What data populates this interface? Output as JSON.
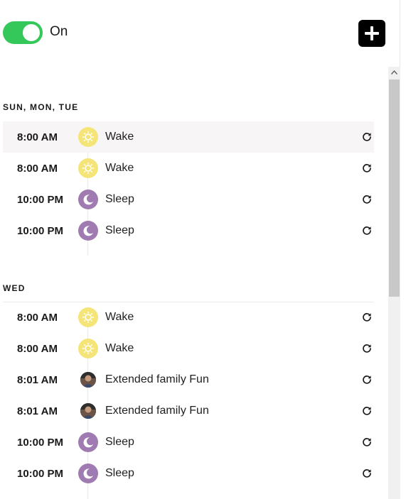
{
  "toggle": {
    "label": "On",
    "state": "on",
    "color": "#34c759"
  },
  "add_button": {
    "icon": "plus-icon"
  },
  "groups": [
    {
      "header": "SUN, MON, TUE",
      "rows": [
        {
          "time": "8:00 AM",
          "icon": "sun-icon",
          "title": "Wake",
          "highlighted": true
        },
        {
          "time": "8:00 AM",
          "icon": "sun-icon",
          "title": "Wake"
        },
        {
          "time": "10:00 PM",
          "icon": "moon-icon",
          "title": "Sleep"
        },
        {
          "time": "10:00 PM",
          "icon": "moon-icon",
          "title": "Sleep"
        }
      ]
    },
    {
      "header": "WED",
      "rows": [
        {
          "time": "8:00 AM",
          "icon": "sun-icon",
          "title": "Wake"
        },
        {
          "time": "8:00 AM",
          "icon": "sun-icon",
          "title": "Wake"
        },
        {
          "time": "8:01 AM",
          "icon": "avatar",
          "title": "Extended family Fun"
        },
        {
          "time": "8:01 AM",
          "icon": "avatar",
          "title": "Extended family Fun"
        },
        {
          "time": "10:00 PM",
          "icon": "moon-icon",
          "title": "Sleep"
        },
        {
          "time": "10:00 PM",
          "icon": "moon-icon",
          "title": "Sleep"
        }
      ]
    }
  ],
  "row_action_icon": "repeat-icon",
  "colors": {
    "sun": "#f5e477",
    "moon": "#a07bb2",
    "highlight_row": "#f7f5f5"
  }
}
